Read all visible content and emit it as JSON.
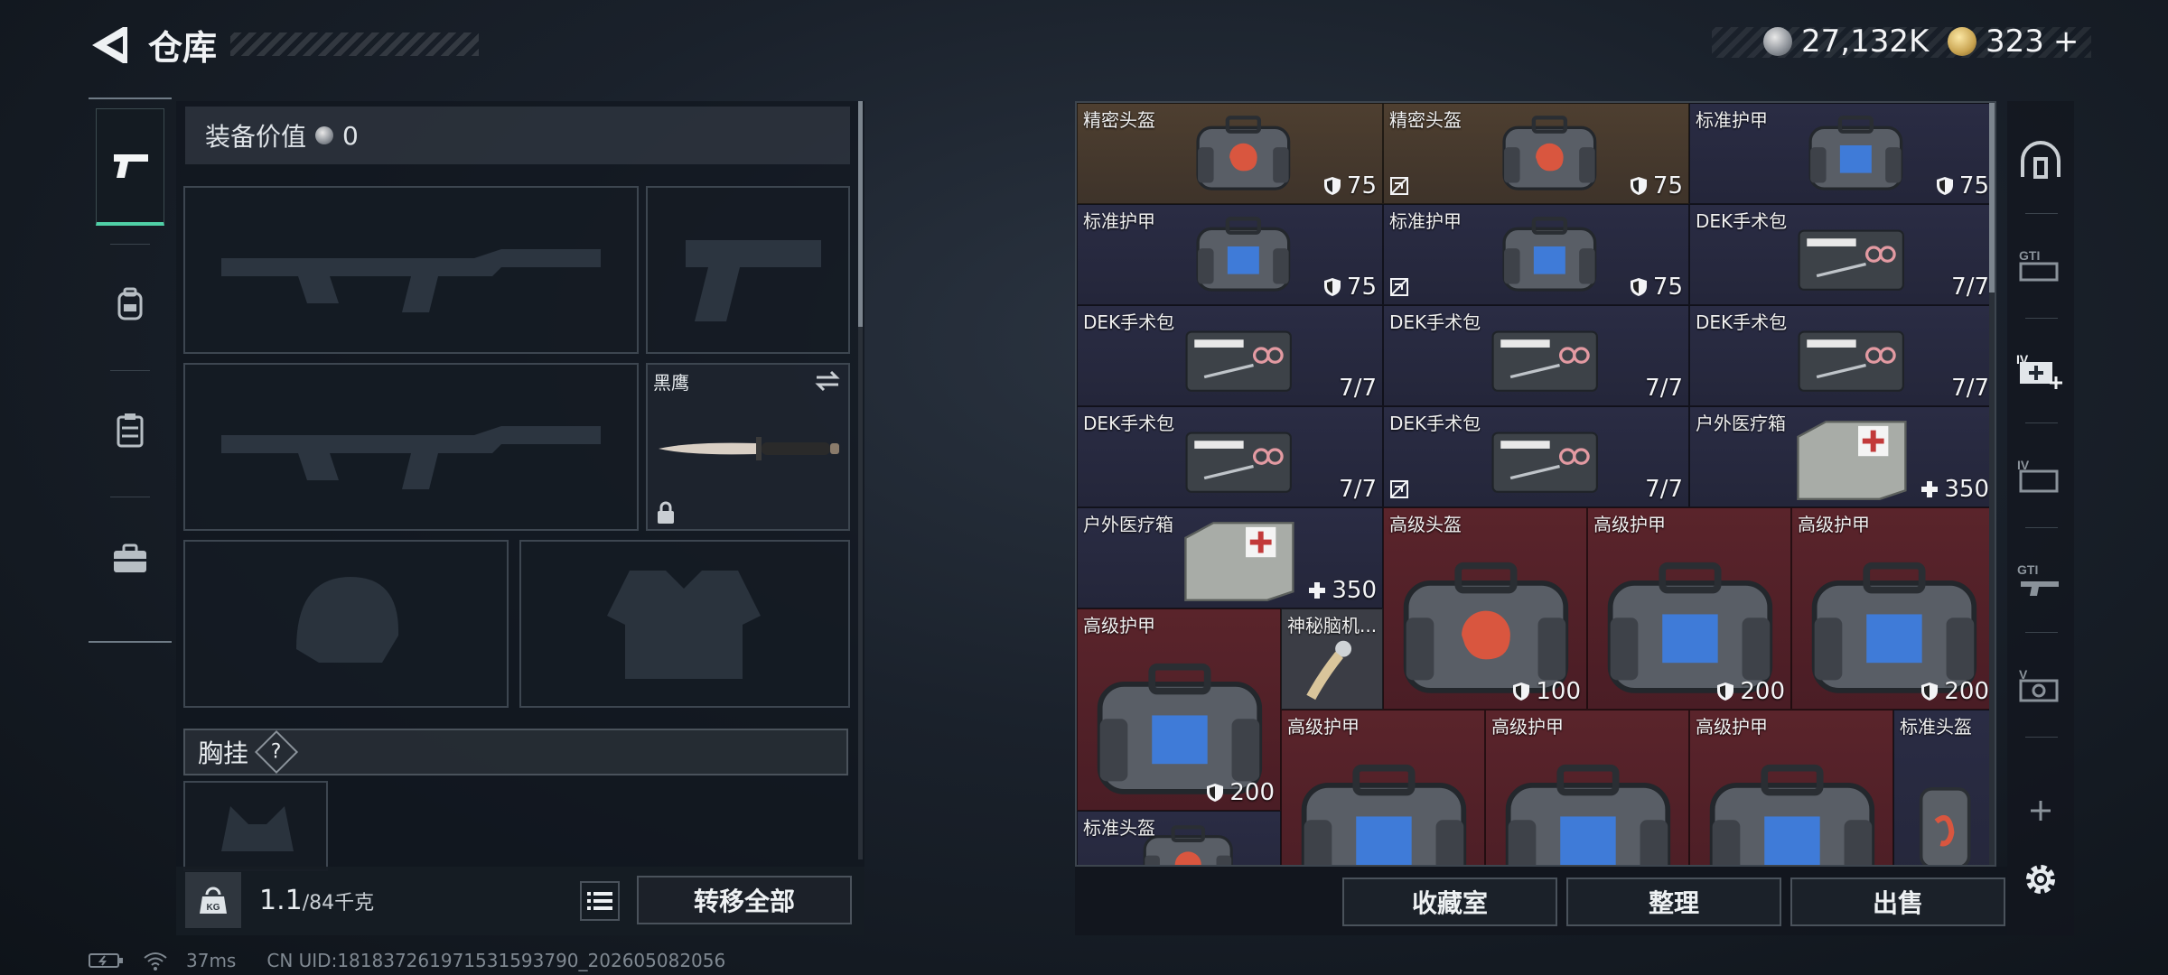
{
  "header": {
    "title": "仓库",
    "currency_1": "27,132K",
    "currency_2": "323",
    "currency_2_plus": "+"
  },
  "loadout": {
    "value_label": "装备价值",
    "value": "0",
    "melee_name": "黑鹰",
    "chest_label": "胸挂",
    "chest_help": "?"
  },
  "weight": {
    "current": "1.1",
    "max": "/84千克"
  },
  "buttons": {
    "transfer_all": "转移全部",
    "collection": "收藏室",
    "organize": "整理",
    "sell": "出售"
  },
  "status": {
    "ping": "37ms",
    "uid": "CN UID:18183726197153159379​0_202605082056"
  },
  "storage": {
    "items": [
      {
        "name": "精密头盔",
        "stat": "75",
        "stat_icon": "shield",
        "tier": "gold",
        "kind": "helmet"
      },
      {
        "name": "精密头盔",
        "stat": "75",
        "stat_icon": "shield",
        "tier": "gold",
        "kind": "helmet",
        "flag": true
      },
      {
        "name": "标准护甲",
        "stat": "75",
        "stat_icon": "shield",
        "tier": "blue",
        "kind": "armor"
      },
      {
        "name": "标准护甲",
        "stat": "75",
        "stat_icon": "shield",
        "tier": "blue",
        "kind": "armor"
      },
      {
        "name": "标准护甲",
        "stat": "75",
        "stat_icon": "shield",
        "tier": "blue",
        "kind": "armor",
        "flag": true
      },
      {
        "name": "DEK手术包",
        "stat": "7/7",
        "tier": "blue",
        "kind": "kit"
      },
      {
        "name": "DEK手术包",
        "stat": "7/7",
        "tier": "blue",
        "kind": "kit"
      },
      {
        "name": "DEK手术包",
        "stat": "7/7",
        "tier": "blue",
        "kind": "kit"
      },
      {
        "name": "DEK手术包",
        "stat": "7/7",
        "tier": "blue",
        "kind": "kit"
      },
      {
        "name": "DEK手术包",
        "stat": "7/7",
        "tier": "blue",
        "kind": "kit"
      },
      {
        "name": "DEK手术包",
        "stat": "7/7",
        "tier": "blue",
        "kind": "kit",
        "flag": true
      },
      {
        "name": "户外医疗箱",
        "stat": "350",
        "stat_icon": "plus",
        "tier": "blue",
        "kind": "medbox"
      },
      {
        "name": "户外医疗箱",
        "stat": "350",
        "stat_icon": "plus",
        "tier": "blue",
        "kind": "medbox"
      },
      {
        "name": "高级头盔",
        "stat": "100",
        "stat_icon": "shield",
        "tier": "red",
        "kind": "helmet-big"
      },
      {
        "name": "高级护甲",
        "stat": "200",
        "stat_icon": "shield",
        "tier": "red",
        "kind": "armor-big"
      },
      {
        "name": "高级护甲",
        "stat": "200",
        "stat_icon": "shield",
        "tier": "red",
        "kind": "armor-big"
      },
      {
        "name": "高级护甲",
        "stat": "200",
        "stat_icon": "shield",
        "tier": "red",
        "kind": "armor-big"
      },
      {
        "name": "神秘脑机...",
        "stat": "",
        "tier": "grey",
        "kind": "chip"
      },
      {
        "name": "高级护甲",
        "stat": "",
        "tier": "red",
        "kind": "armor-big"
      },
      {
        "name": "高级护甲",
        "stat": "",
        "tier": "red",
        "kind": "armor-big"
      },
      {
        "name": "高级护甲",
        "stat": "",
        "tier": "red",
        "kind": "armor-big"
      },
      {
        "name": "标准头盔",
        "stat": "",
        "tier": "blue",
        "kind": "helmet-small"
      },
      {
        "name": "标准头盔",
        "stat": "",
        "tier": "blue",
        "kind": "helmet"
      }
    ]
  },
  "colors": {
    "accent": "#4fd0a6",
    "gold_tier": "#4e3f30",
    "blue_tier": "#2a2c44",
    "red_tier": "#5a242b"
  },
  "right_nav_icons": [
    "bunker-icon",
    "gti-storage-icon",
    "medical-storage-icon",
    "iv-storage-icon",
    "gti-weapon-storage-icon",
    "v-storage-icon",
    "add-icon",
    "settings-icon"
  ]
}
